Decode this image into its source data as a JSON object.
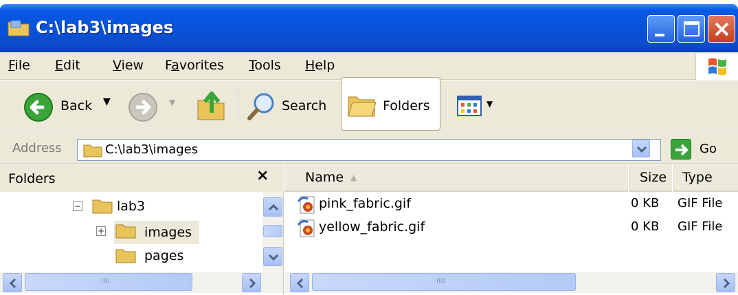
{
  "window": {
    "title": "C:\\lab3\\images"
  },
  "menu": {
    "file": {
      "mn": "F",
      "rest": "ile"
    },
    "edit": {
      "mn": "E",
      "rest": "dit"
    },
    "view": {
      "mn": "V",
      "rest": "iew"
    },
    "favorites": {
      "pre": "F",
      "mn": "a",
      "rest": "vorites"
    },
    "tools": {
      "mn": "T",
      "rest": "ools"
    },
    "help": {
      "mn": "H",
      "rest": "elp"
    }
  },
  "toolbar": {
    "back_label": "Back",
    "search_label": "Search",
    "folders_label": "Folders"
  },
  "address": {
    "label": "Address",
    "value": "C:\\lab3\\images",
    "go_label": "Go"
  },
  "folders_pane": {
    "title": "Folders",
    "close_glyph": "×",
    "tree": [
      {
        "label": "lab3",
        "expander": "−"
      },
      {
        "label": "images",
        "expander": "+"
      },
      {
        "label": "pages",
        "expander": ""
      }
    ]
  },
  "file_list": {
    "columns": {
      "name": "Name",
      "size": "Size",
      "type": "Type"
    },
    "files": [
      {
        "name": "pink_fabric.gif",
        "size": "0 KB",
        "type": "GIF File"
      },
      {
        "name": "yellow_fabric.gif",
        "size": "0 KB",
        "type": "GIF File"
      }
    ],
    "scroll_grip": "IIII"
  },
  "colors": {
    "titlebar": "#0852d8",
    "chrome": "#ece9d8",
    "selection": "#ece9d8",
    "close_button": "#c3401f"
  },
  "icons": [
    "folder-icon",
    "minimize-icon",
    "maximize-icon",
    "close-icon",
    "windows-logo-icon",
    "back-arrow-icon",
    "forward-arrow-icon",
    "up-folder-icon",
    "search-icon",
    "folders-icon",
    "views-icon",
    "go-arrow-icon",
    "gif-file-icon"
  ]
}
